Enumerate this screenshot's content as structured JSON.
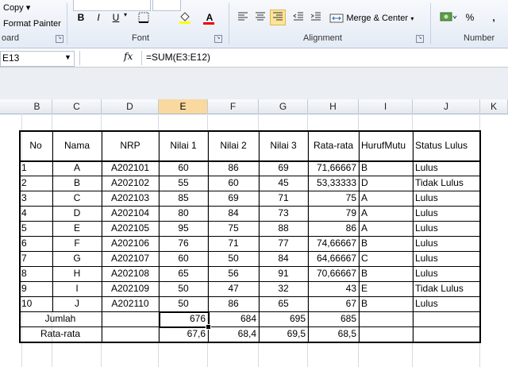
{
  "ribbon": {
    "copy": "Copy",
    "format_painter": "Format Painter",
    "clipboard_group": "oard",
    "font_group": "Font",
    "alignment_group": "Alignment",
    "number_group": "Number",
    "bold": "B",
    "italic": "I",
    "underline": "U",
    "font_color_letter": "A",
    "merge_center": "Merge & Center",
    "percent": "%",
    "comma": ","
  },
  "formula_bar": {
    "name_box": "E13",
    "fx": "fx",
    "formula": "=SUM(E3:E12)"
  },
  "columns": [
    "B",
    "C",
    "D",
    "E",
    "F",
    "G",
    "H",
    "I",
    "J",
    "K"
  ],
  "selected_column": "E",
  "table": {
    "headers": [
      "No",
      "Nama",
      "NRP",
      "Nilai 1",
      "Nilai 2",
      "Nilai 3",
      "Rata-rata",
      "HurufMutu",
      "Status Lulus"
    ],
    "rows": [
      [
        "1",
        "A",
        "A202101",
        "60",
        "86",
        "69",
        "71,66667",
        "B",
        "Lulus"
      ],
      [
        "2",
        "B",
        "A202102",
        "55",
        "60",
        "45",
        "53,33333",
        "D",
        "Tidak Lulus"
      ],
      [
        "3",
        "C",
        "A202103",
        "85",
        "69",
        "71",
        "75",
        "A",
        "Lulus"
      ],
      [
        "4",
        "D",
        "A202104",
        "80",
        "84",
        "73",
        "79",
        "A",
        "Lulus"
      ],
      [
        "5",
        "E",
        "A202105",
        "95",
        "75",
        "88",
        "86",
        "A",
        "Lulus"
      ],
      [
        "6",
        "F",
        "A202106",
        "76",
        "71",
        "77",
        "74,66667",
        "B",
        "Lulus"
      ],
      [
        "7",
        "G",
        "A202107",
        "60",
        "50",
        "84",
        "64,66667",
        "C",
        "Lulus"
      ],
      [
        "8",
        "H",
        "A202108",
        "65",
        "56",
        "91",
        "70,66667",
        "B",
        "Lulus"
      ],
      [
        "9",
        "I",
        "A202109",
        "50",
        "47",
        "32",
        "43",
        "E",
        "Tidak Lulus"
      ],
      [
        "10",
        "J",
        "A202110",
        "50",
        "86",
        "65",
        "67",
        "B",
        "Lulus"
      ]
    ],
    "jumlah": {
      "label": "Jumlah",
      "e": "676",
      "f": "684",
      "g": "695",
      "h": "685"
    },
    "ratarata": {
      "label": "Rata-rata",
      "e": "67,6",
      "f": "68,4",
      "g": "69,5",
      "h": "68,5"
    }
  }
}
